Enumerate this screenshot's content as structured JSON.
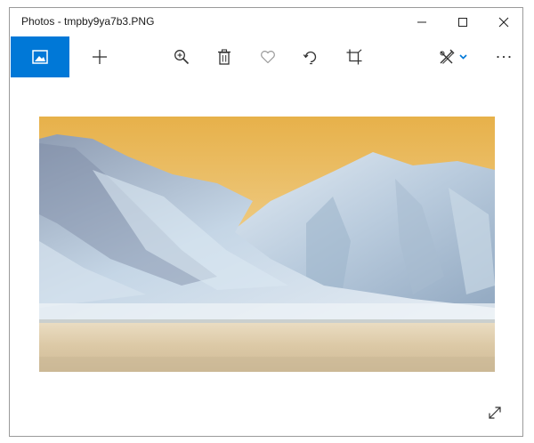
{
  "window": {
    "title": "Photos - tmpby9ya7b3.PNG"
  },
  "titlebar_buttons": [
    {
      "name": "minimize-button",
      "icon": "minimize-icon"
    },
    {
      "name": "maximize-button",
      "icon": "maximize-icon"
    },
    {
      "name": "close-button",
      "icon": "close-icon"
    }
  ],
  "toolbar": {
    "buttons": [
      {
        "name": "home-collection-button",
        "icon": "picture-icon"
      },
      {
        "name": "add-to-button",
        "icon": "plus-icon"
      },
      {
        "name": "zoom-button",
        "icon": "zoom-in-icon"
      },
      {
        "name": "delete-button",
        "icon": "trash-icon"
      },
      {
        "name": "favorite-button",
        "icon": "heart-icon"
      },
      {
        "name": "rotate-button",
        "icon": "rotate-icon"
      },
      {
        "name": "crop-button",
        "icon": "crop-icon"
      },
      {
        "name": "edit-create-button",
        "icon": "edit-pencil-icon"
      },
      {
        "name": "more-options-button",
        "icon": "ellipsis-icon"
      }
    ]
  },
  "viewer": {
    "expand_icon": "expand-diagonal-icon"
  },
  "colors": {
    "accent": "#0078d7",
    "sky_top": "#e7b44a",
    "mountain": "#c8d8e6",
    "ground": "#d7c7a6"
  }
}
